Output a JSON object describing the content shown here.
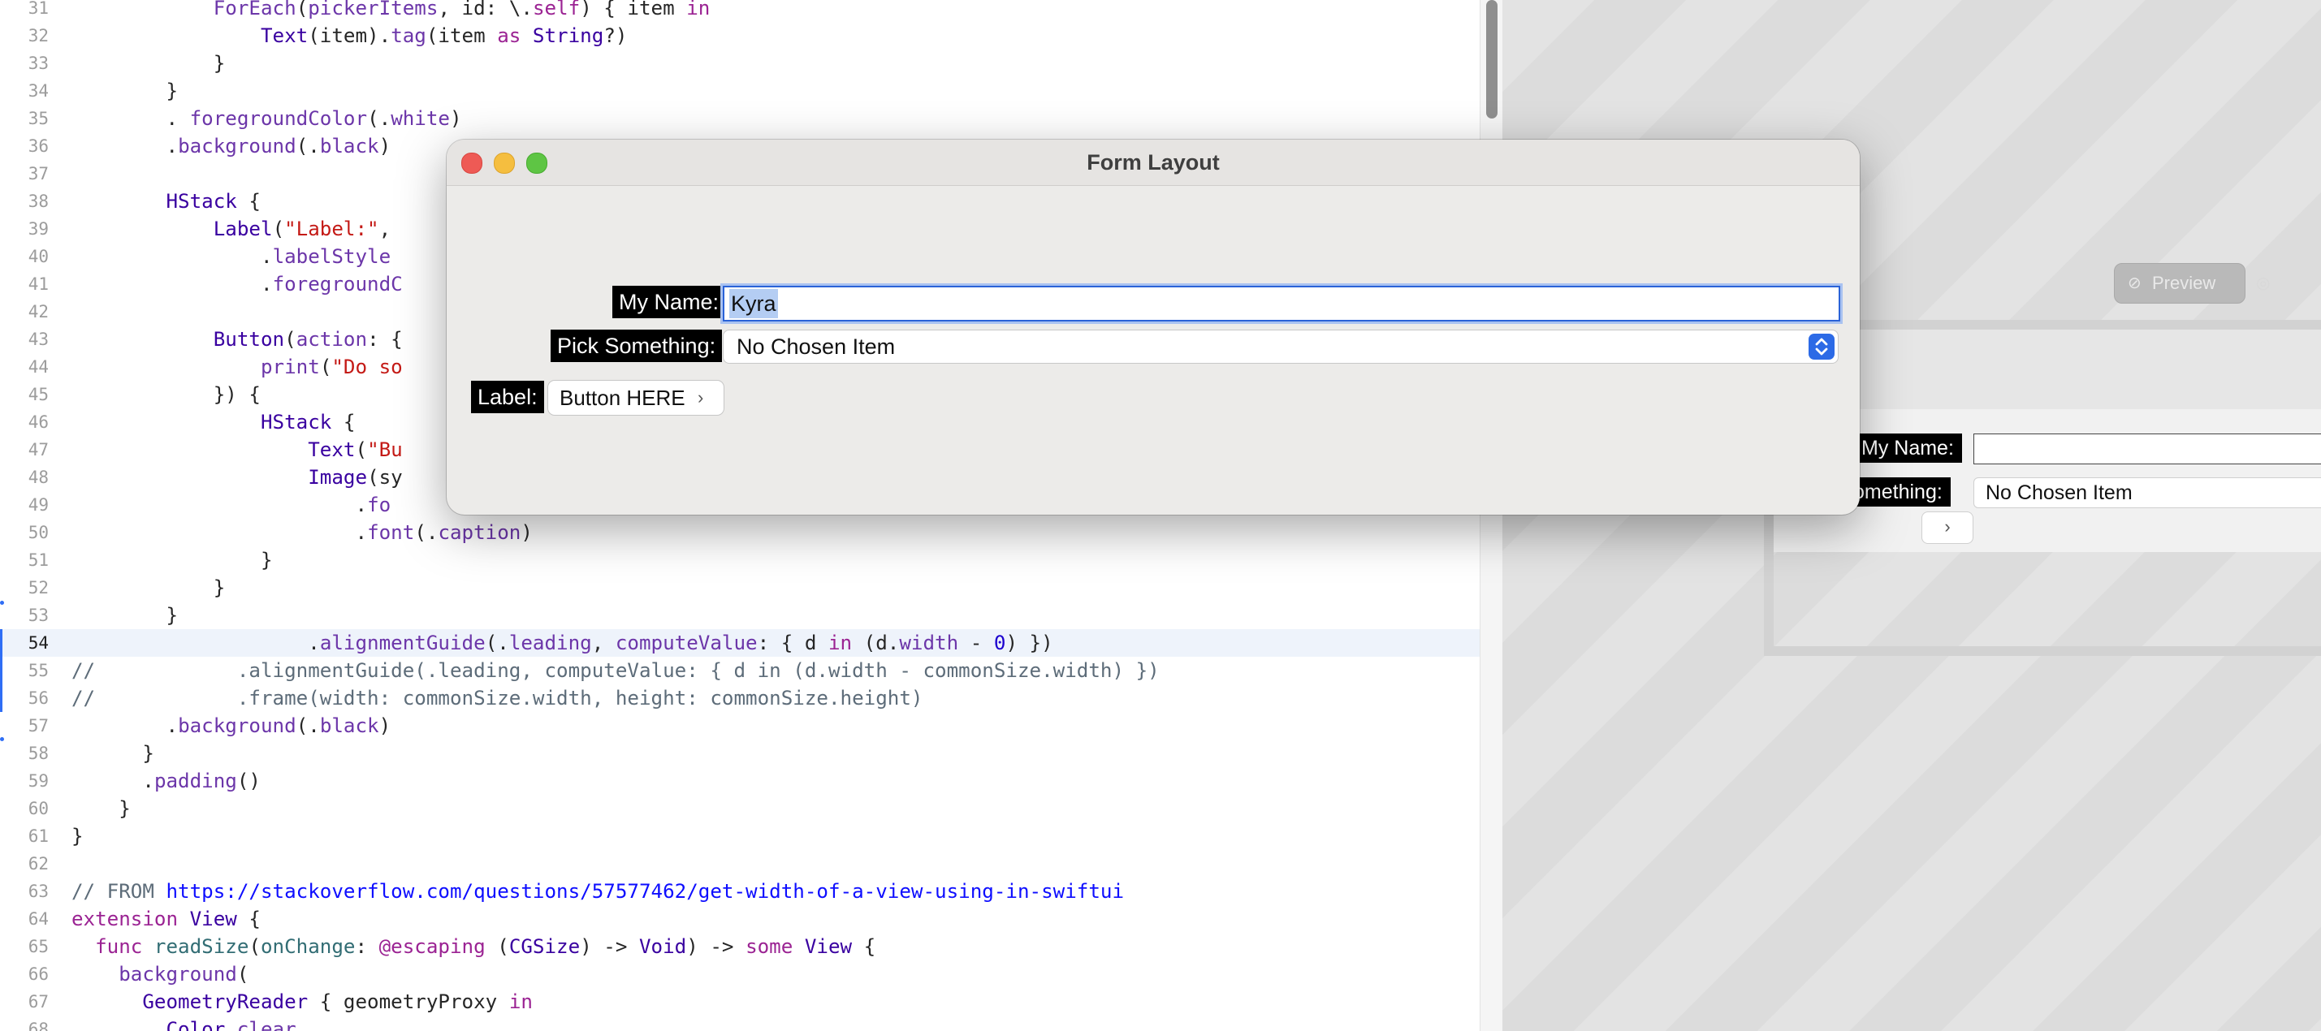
{
  "editor": {
    "lines": [
      {
        "n": "31",
        "indent": "            ",
        "tokens": [
          [
            "md",
            "ForEach"
          ],
          [
            "",
            "("
          ],
          [
            "md",
            "pickerItems"
          ],
          [
            "",
            ", id: \\."
          ],
          [
            "kw",
            "self"
          ],
          [
            "",
            ") { item "
          ],
          [
            "kw",
            "in"
          ]
        ]
      },
      {
        "n": "32",
        "indent": "                ",
        "tokens": [
          [
            "ty",
            "Text"
          ],
          [
            "",
            "(item)."
          ],
          [
            "md",
            "tag"
          ],
          [
            "",
            "(item "
          ],
          [
            "kw",
            "as"
          ],
          [
            "",
            ""
          ],
          [
            "ty",
            " String"
          ],
          [
            "",
            "?)"
          ]
        ]
      },
      {
        "n": "33",
        "indent": "            ",
        "tokens": [
          [
            "",
            "}"
          ]
        ]
      },
      {
        "n": "34",
        "indent": "        ",
        "tokens": [
          [
            "",
            "}"
          ]
        ]
      },
      {
        "n": "35",
        "indent": "        ",
        "tokens": [
          [
            "",
            ". "
          ],
          [
            "md",
            "foregroundColor"
          ],
          [
            "",
            "(."
          ],
          [
            "md",
            "white"
          ],
          [
            "",
            ")"
          ]
        ]
      },
      {
        "n": "36",
        "indent": "        ",
        "tokens": [
          [
            "",
            "."
          ],
          [
            "md",
            "background"
          ],
          [
            "",
            "(."
          ],
          [
            "md",
            "black"
          ],
          [
            "",
            ")"
          ]
        ]
      },
      {
        "n": "37",
        "indent": "",
        "tokens": []
      },
      {
        "n": "38",
        "indent": "        ",
        "tokens": [
          [
            "ty",
            "HStack"
          ],
          [
            "",
            " {"
          ]
        ]
      },
      {
        "n": "39",
        "indent": "            ",
        "tokens": [
          [
            "ty",
            "Label"
          ],
          [
            "",
            "("
          ],
          [
            "str",
            "\"Label:\""
          ],
          [
            "",
            ","
          ]
        ]
      },
      {
        "n": "40",
        "indent": "                ",
        "tokens": [
          [
            "",
            "."
          ],
          [
            "md",
            "labelStyle"
          ]
        ]
      },
      {
        "n": "41",
        "indent": "                ",
        "tokens": [
          [
            "",
            "."
          ],
          [
            "md",
            "foregroundC"
          ]
        ]
      },
      {
        "n": "42",
        "indent": "",
        "tokens": []
      },
      {
        "n": "43",
        "indent": "            ",
        "tokens": [
          [
            "ty",
            "Button"
          ],
          [
            "",
            "("
          ],
          [
            "md",
            "action"
          ],
          [
            "",
            ": {"
          ]
        ]
      },
      {
        "n": "44",
        "indent": "                ",
        "tokens": [
          [
            "md",
            "print"
          ],
          [
            "",
            "("
          ],
          [
            "str",
            "\"Do so"
          ]
        ]
      },
      {
        "n": "45",
        "indent": "            ",
        "tokens": [
          [
            "",
            "}) {"
          ]
        ]
      },
      {
        "n": "46",
        "indent": "                ",
        "tokens": [
          [
            "ty",
            "HStack"
          ],
          [
            "",
            " {"
          ]
        ]
      },
      {
        "n": "47",
        "indent": "                    ",
        "tokens": [
          [
            "ty",
            "Text"
          ],
          [
            "",
            "("
          ],
          [
            "str",
            "\"Bu"
          ]
        ]
      },
      {
        "n": "48",
        "indent": "                    ",
        "tokens": [
          [
            "ty",
            "Image"
          ],
          [
            "",
            "(sy"
          ]
        ]
      },
      {
        "n": "49",
        "indent": "                        ",
        "tokens": [
          [
            "",
            "."
          ],
          [
            "md",
            "fo"
          ]
        ]
      },
      {
        "n": "50",
        "indent": "                        ",
        "tokens": [
          [
            "",
            "."
          ],
          [
            "md",
            "font"
          ],
          [
            "",
            "(."
          ],
          [
            "md",
            "caption"
          ],
          [
            "",
            ")"
          ]
        ]
      },
      {
        "n": "51",
        "indent": "                ",
        "tokens": [
          [
            "",
            "}"
          ]
        ]
      },
      {
        "n": "52",
        "indent": "            ",
        "tokens": [
          [
            "",
            "}"
          ]
        ]
      },
      {
        "n": "53",
        "indent": "        ",
        "tokens": [
          [
            "",
            "}"
          ]
        ]
      },
      {
        "n": "54",
        "indent": "                    ",
        "tokens": [
          [
            "",
            "."
          ],
          [
            "md",
            "alignmentGuide"
          ],
          [
            "",
            "(."
          ],
          [
            "md",
            "leading"
          ],
          [
            "",
            ", "
          ],
          [
            "md",
            "computeValue"
          ],
          [
            "",
            ": { d "
          ],
          [
            "kw",
            "in"
          ],
          [
            "",
            " (d."
          ],
          [
            "md",
            "width"
          ],
          [
            "",
            " - "
          ],
          [
            "num",
            "0"
          ],
          [
            "",
            ") })"
          ]
        ]
      },
      {
        "n": "55",
        "indent": "",
        "tokens": [
          [
            "cm",
            "//            .alignmentGuide(.leading, computeValue: { d in (d.width - commonSize.width) })"
          ]
        ]
      },
      {
        "n": "56",
        "indent": "",
        "tokens": [
          [
            "cm",
            "//            .frame(width: commonSize.width, height: commonSize.height)"
          ]
        ]
      },
      {
        "n": "57",
        "indent": "        ",
        "tokens": [
          [
            "",
            "."
          ],
          [
            "md",
            "background"
          ],
          [
            "",
            "(."
          ],
          [
            "md",
            "black"
          ],
          [
            "",
            ")"
          ]
        ]
      },
      {
        "n": "58",
        "indent": "      ",
        "tokens": [
          [
            "",
            "}"
          ]
        ]
      },
      {
        "n": "59",
        "indent": "      ",
        "tokens": [
          [
            "",
            "."
          ],
          [
            "md",
            "padding"
          ],
          [
            "",
            "()"
          ]
        ]
      },
      {
        "n": "60",
        "indent": "    ",
        "tokens": [
          [
            "",
            "}"
          ]
        ]
      },
      {
        "n": "61",
        "indent": "",
        "tokens": [
          [
            "",
            "}"
          ]
        ]
      },
      {
        "n": "62",
        "indent": "",
        "tokens": []
      },
      {
        "n": "63",
        "indent": "",
        "tokens": [
          [
            "cm",
            "// FROM "
          ],
          [
            "url",
            "https://stackoverflow.com/questions/57577462/get-width-of-a-view-using-in-swiftui"
          ]
        ]
      },
      {
        "n": "64",
        "indent": "",
        "tokens": [
          [
            "kw",
            "extension"
          ],
          [
            "",
            ""
          ],
          [
            "ty",
            " View"
          ],
          [
            "",
            " {"
          ]
        ]
      },
      {
        "n": "65",
        "indent": "  ",
        "tokens": [
          [
            "kw",
            "func"
          ],
          [
            "",
            ""
          ],
          [
            "fn",
            " readSize"
          ],
          [
            "",
            "("
          ],
          [
            "fn",
            "onChange"
          ],
          [
            "",
            ": "
          ],
          [
            "kw",
            "@escaping"
          ],
          [
            "",
            " ("
          ],
          [
            "ty",
            "CGSize"
          ],
          [
            "",
            ") -> "
          ],
          [
            "ty",
            "Void"
          ],
          [
            "",
            ") -> "
          ],
          [
            "kw",
            "some"
          ],
          [
            "",
            ""
          ],
          [
            "ty",
            " View"
          ],
          [
            "",
            " {"
          ]
        ]
      },
      {
        "n": "66",
        "indent": "    ",
        "tokens": [
          [
            "md",
            "background"
          ],
          [
            "",
            "("
          ]
        ]
      },
      {
        "n": "67",
        "indent": "      ",
        "tokens": [
          [
            "ty",
            "GeometryReader"
          ],
          [
            "",
            " { geometryProxy "
          ],
          [
            "kw",
            "in"
          ]
        ]
      },
      {
        "n": "68",
        "indent": "        ",
        "tokens": [
          [
            "ty",
            "Color"
          ],
          [
            "",
            "."
          ],
          [
            "md",
            "clear"
          ]
        ]
      }
    ]
  },
  "preview": {
    "pill_label": "Preview",
    "name_label": "My Name:",
    "pick_label": "omething:",
    "pick_value": "No Chosen Item",
    "button_chevron": "›"
  },
  "window": {
    "title": "Form Layout",
    "name_label": "My Name:",
    "name_value": "Kyra",
    "pick_label": "Pick Something:",
    "pick_value": "No Chosen Item",
    "button_label": "Label:",
    "button_text": "Button HERE",
    "button_chevron": "›"
  },
  "colors": {
    "accent": "#2c6ae6",
    "close": "#ee5a55",
    "minimize": "#f5be3f",
    "maximize": "#5ec544"
  }
}
